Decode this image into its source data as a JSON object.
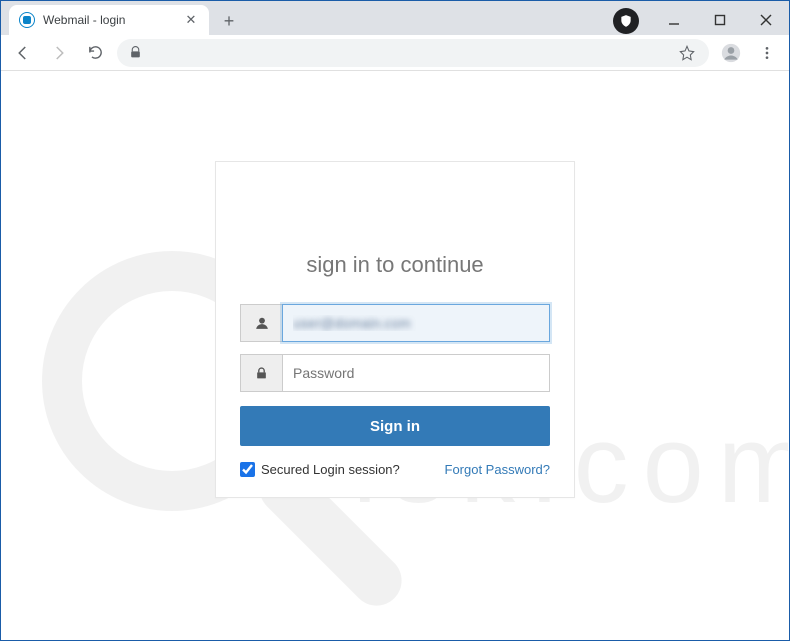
{
  "window": {
    "title": "Webmail - login"
  },
  "toolbar": {
    "star_tip": "Bookmark",
    "profile_tip": "You",
    "menu_tip": "Menu"
  },
  "login": {
    "heading": "sign in to continue",
    "username_value": "user@domain.com",
    "password_placeholder": "Password",
    "signin_label": "Sign in",
    "secured_label": "Secured Login session?",
    "secured_checked": true,
    "forgot_label": "Forgot Password?"
  }
}
